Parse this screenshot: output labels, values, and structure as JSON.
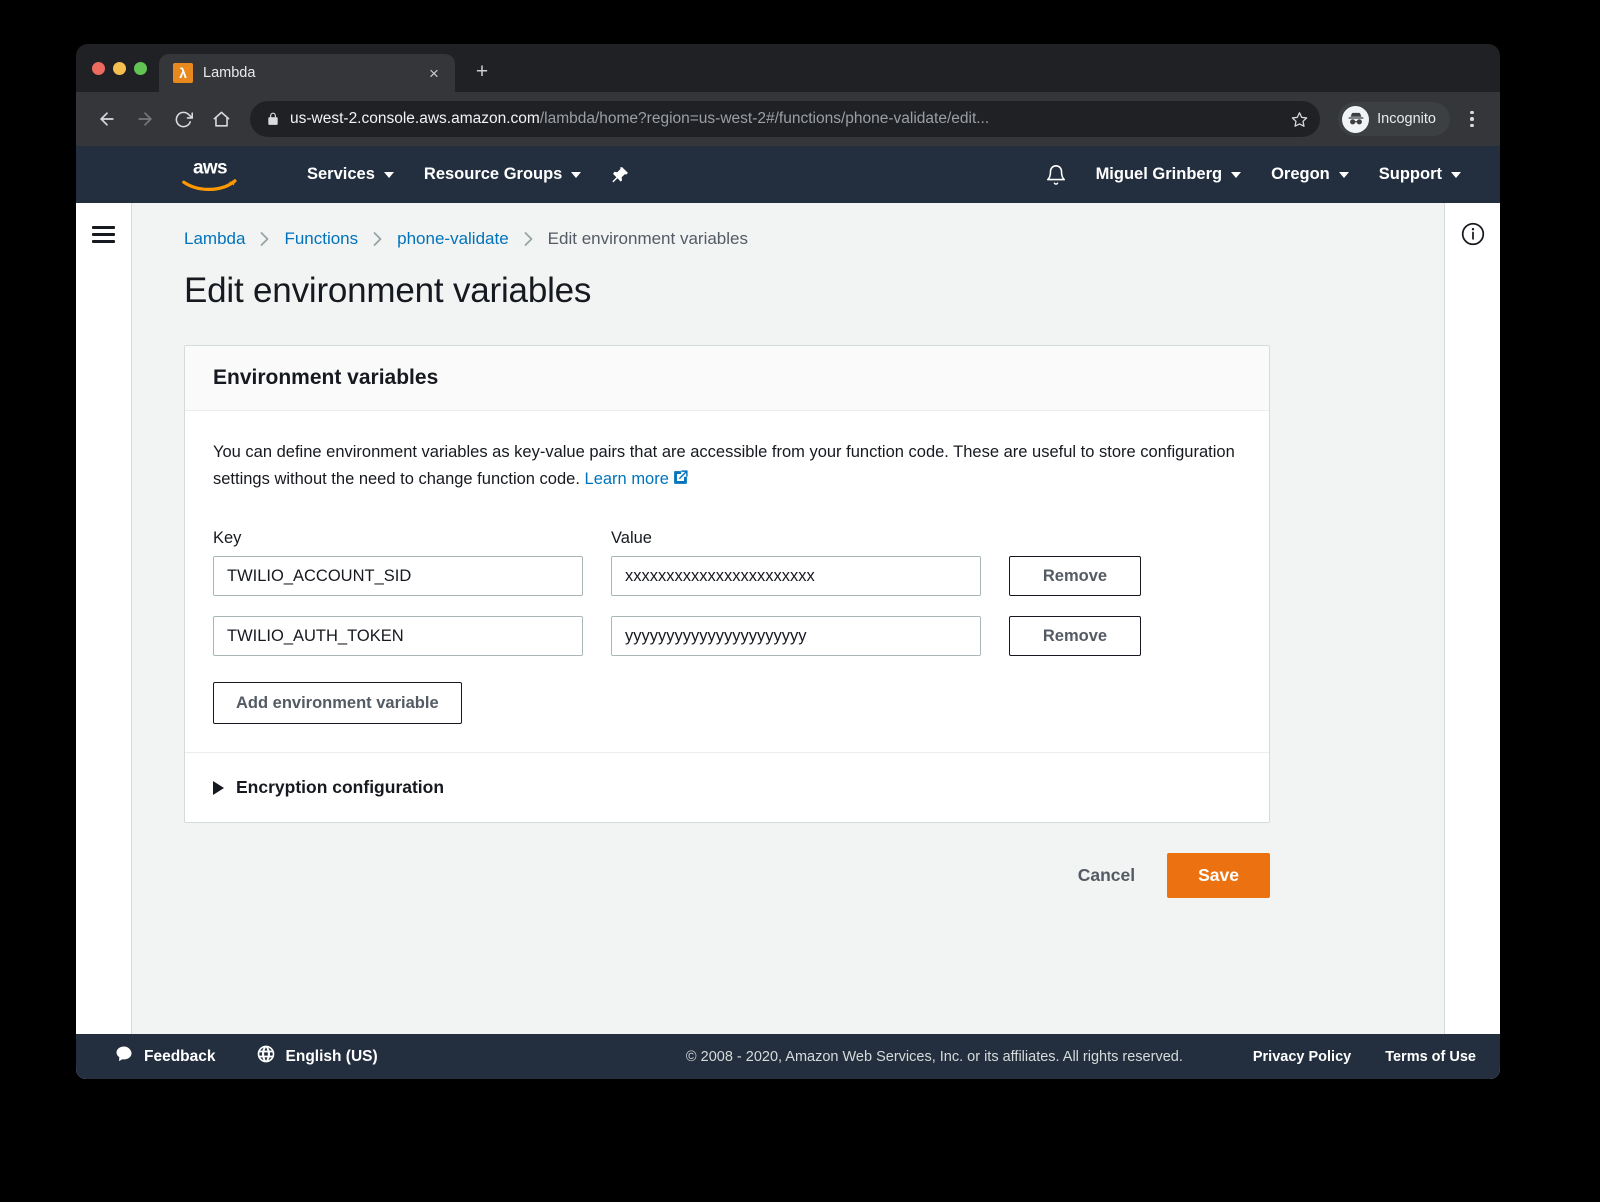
{
  "browser": {
    "tab": {
      "title": "Lambda",
      "favicon": "lambda-icon",
      "close": "×"
    },
    "new_tab": "+",
    "nav": {
      "back": "back-icon",
      "forward": "forward-icon",
      "reload": "reload-icon",
      "home": "home-icon"
    },
    "omnibox": {
      "lock": "lock-icon",
      "url_host": "us-west-2.console.aws.amazon.com",
      "url_path": "/lambda/home?region=us-west-2#/functions/phone-validate/edit...",
      "star": "star-icon"
    },
    "profile": {
      "label": "Incognito",
      "icon": "incognito-icon"
    },
    "menu": "kebab-menu-icon"
  },
  "aws_nav": {
    "logo": "aws-logo",
    "services": "Services",
    "resource_groups": "Resource Groups",
    "pin": "pin-icon",
    "bell": "bell-icon",
    "account": "Miguel Grinberg",
    "region": "Oregon",
    "support": "Support"
  },
  "rails": {
    "hamburger": "hamburger-icon",
    "info": "info-icon"
  },
  "breadcrumb": {
    "items": [
      {
        "label": "Lambda",
        "current": false
      },
      {
        "label": "Functions",
        "current": false
      },
      {
        "label": "phone-validate",
        "current": false
      },
      {
        "label": "Edit environment variables",
        "current": true
      }
    ],
    "separator": "›"
  },
  "page": {
    "title": "Edit environment variables"
  },
  "card": {
    "header": "Environment variables",
    "description": "You can define environment variables as key-value pairs that are accessible from your function code. These are useful to store configuration settings without the need to change function code.",
    "learn_more": "Learn more",
    "columns": {
      "key": "Key",
      "value": "Value"
    },
    "rows": [
      {
        "key": "TWILIO_ACCOUNT_SID",
        "value": "xxxxxxxxxxxxxxxxxxxxxxx",
        "remove_label": "Remove"
      },
      {
        "key": "TWILIO_AUTH_TOKEN",
        "value": "yyyyyyyyyyyyyyyyyyyyyy",
        "remove_label": "Remove"
      }
    ],
    "add_label": "Add environment variable",
    "encryption_label": "Encryption configuration"
  },
  "actions": {
    "cancel": "Cancel",
    "save": "Save"
  },
  "footer": {
    "feedback": "Feedback",
    "language": "English (US)",
    "copyright": "© 2008 - 2020, Amazon Web Services, Inc. or its affiliates. All rights reserved.",
    "privacy": "Privacy Policy",
    "terms": "Terms of Use"
  },
  "colors": {
    "aws_navy": "#232f3e",
    "aws_orange": "#ec7211",
    "link_blue": "#0073bb",
    "page_bg": "#f2f3f3"
  }
}
